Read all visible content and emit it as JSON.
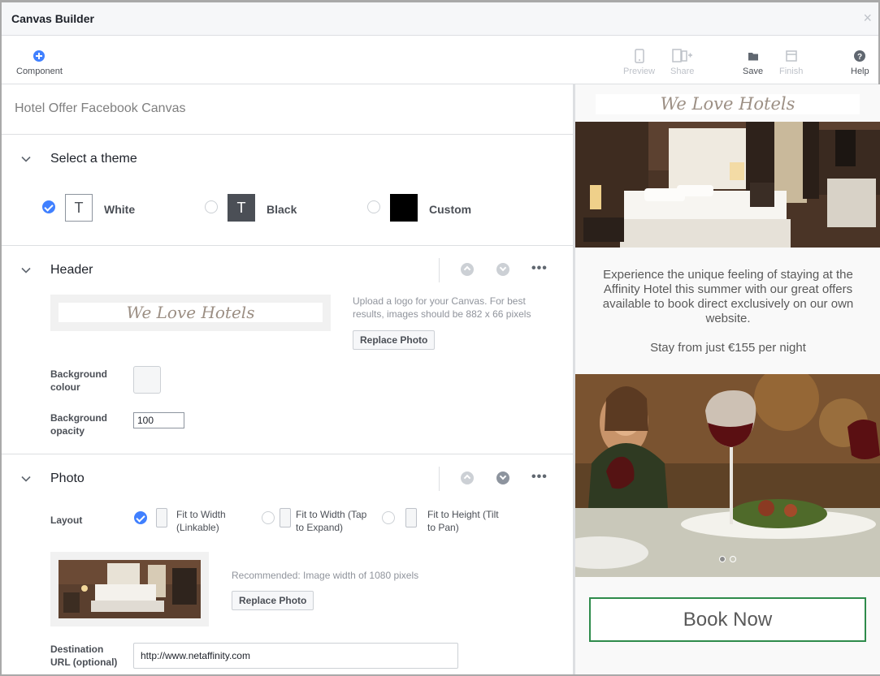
{
  "window": {
    "title": "Canvas Builder",
    "close_label": "×"
  },
  "toolbar": {
    "component": "Component",
    "preview": "Preview",
    "share": "Share",
    "save": "Save",
    "finish": "Finish",
    "help": "Help"
  },
  "canvas_name": "Hotel Offer Facebook Canvas",
  "theme_section": {
    "title": "Select a theme",
    "options": [
      {
        "label": "White",
        "glyph": "T",
        "selected": true
      },
      {
        "label": "Black",
        "glyph": "T",
        "selected": false
      },
      {
        "label": "Custom",
        "glyph": "",
        "selected": false
      }
    ]
  },
  "header_section": {
    "title": "Header",
    "logo_text": "We Love Hotels",
    "upload_help": "Upload a logo for your Canvas. For best results, images should be 882 x 66 pixels",
    "replace_photo": "Replace Photo",
    "bg_colour_label": "Background colour",
    "bg_opacity_label": "Background opacity",
    "bg_opacity_value": "100",
    "more": "•••"
  },
  "photo_section": {
    "title": "Photo",
    "layout_label": "Layout",
    "layout_options": [
      {
        "label": "Fit to Width (Linkable)",
        "selected": true
      },
      {
        "label": "Fit to Width (Tap to Expand)",
        "selected": false
      },
      {
        "label": "Fit to Height (Tilt to Pan)",
        "selected": false
      }
    ],
    "recommended": "Recommended: Image width of 1080 pixels",
    "replace_photo": "Replace Photo",
    "destination_label": "Destination URL (optional)",
    "destination_value": "http://www.netaffinity.com",
    "more": "•••"
  },
  "preview": {
    "logo_text": "We Love Hotels",
    "description": "Experience the unique feeling of staying at the Affinity Hotel this summer with our great offers available to book direct exclusively on our own website.",
    "price_line": "Stay from just €155 per night",
    "carousel_dots": 2,
    "book_button": "Book Now"
  },
  "colors": {
    "accent": "#4080ff",
    "book_border": "#2e8b4b",
    "black_theme": "#4b4f56"
  }
}
